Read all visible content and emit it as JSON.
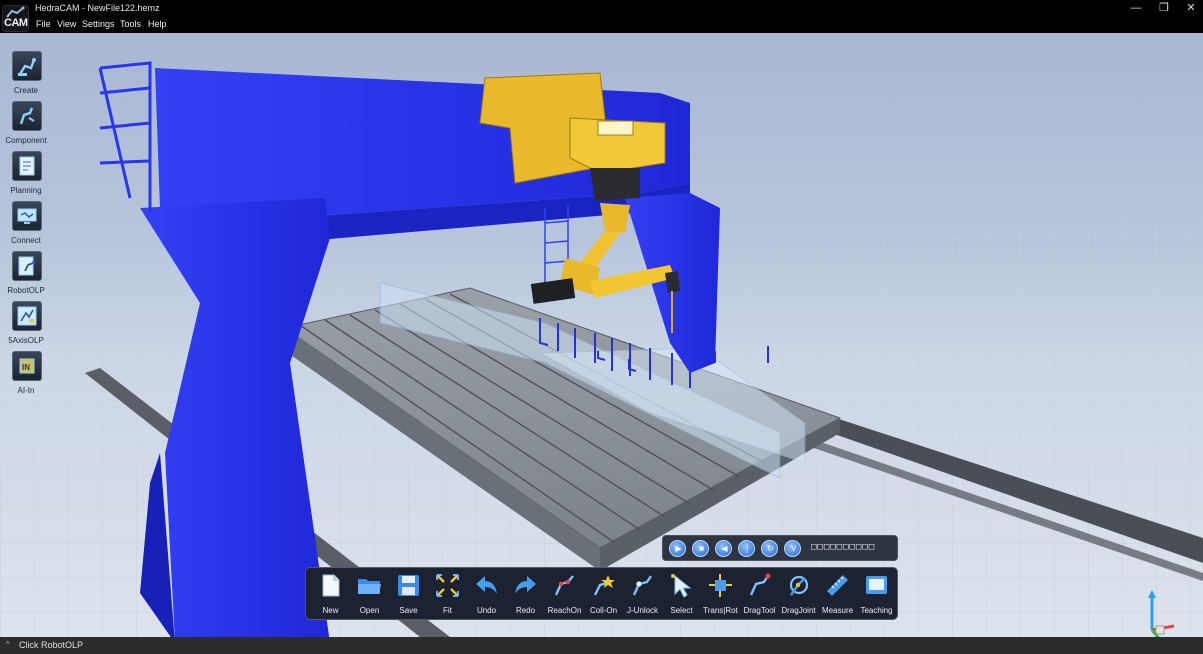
{
  "window": {
    "title": "HedraCAM - NewFile122.hemz",
    "logo_text": "CAM",
    "minimize_glyph": "—",
    "restore_glyph": "❐",
    "close_glyph": "✕"
  },
  "menu": {
    "items": [
      "File",
      "View",
      "Settings",
      "Tools",
      "Help"
    ]
  },
  "left_toolbar": {
    "items": [
      {
        "label": "Create",
        "icon": "create-robot-icon"
      },
      {
        "label": "Component",
        "icon": "component-icon"
      },
      {
        "label": "Planning",
        "icon": "planning-icon"
      },
      {
        "label": "Connect",
        "icon": "connect-icon"
      },
      {
        "label": "RobotOLP",
        "icon": "robot-olp-icon"
      },
      {
        "label": "5AxisOLP",
        "icon": "five-axis-olp-icon"
      },
      {
        "label": "AI-In",
        "icon": "ai-in-icon"
      }
    ]
  },
  "playbar": {
    "buttons": [
      {
        "icon": "play-icon",
        "glyph": "▶"
      },
      {
        "icon": "stop-icon",
        "glyph": "■"
      },
      {
        "icon": "rewind-icon",
        "glyph": "◀"
      },
      {
        "icon": "timer-icon",
        "glyph": "│"
      },
      {
        "icon": "step-icon",
        "glyph": "↻"
      },
      {
        "icon": "verify-icon",
        "glyph": "V"
      }
    ],
    "readout": "□□□□□□□□□□"
  },
  "bottom_toolbar": {
    "items": [
      {
        "label": "New",
        "icon": "new-file-icon"
      },
      {
        "label": "Open",
        "icon": "open-folder-icon"
      },
      {
        "label": "Save",
        "icon": "save-icon"
      },
      {
        "label": "Fit",
        "icon": "fit-view-icon"
      },
      {
        "label": "Undo",
        "icon": "undo-icon"
      },
      {
        "label": "Redo",
        "icon": "redo-icon"
      },
      {
        "label": "ReachOn",
        "icon": "reach-on-icon"
      },
      {
        "label": "Coll-On",
        "icon": "collision-on-icon"
      },
      {
        "label": "J-Unlock",
        "icon": "joint-unlock-icon"
      },
      {
        "label": "Select",
        "icon": "select-cursor-icon"
      },
      {
        "label": "Trans|Rot",
        "icon": "trans-rot-icon"
      },
      {
        "label": "DragTool",
        "icon": "drag-tool-icon"
      },
      {
        "label": "DragJoint",
        "icon": "drag-joint-icon"
      },
      {
        "label": "Measure",
        "icon": "measure-ruler-icon"
      },
      {
        "label": "Teaching",
        "icon": "teaching-pendant-icon"
      }
    ]
  },
  "status": {
    "icon": "expand-up-icon",
    "glyph": "⌃",
    "text": "Click RobotOLP"
  },
  "colors": {
    "gantry": "#2a35ee",
    "robot": "#e8b92a",
    "table": "#8e949c",
    "rail": "#4a4e56",
    "sky_top": "#a8b8d2",
    "floor": "#dde3ec"
  }
}
